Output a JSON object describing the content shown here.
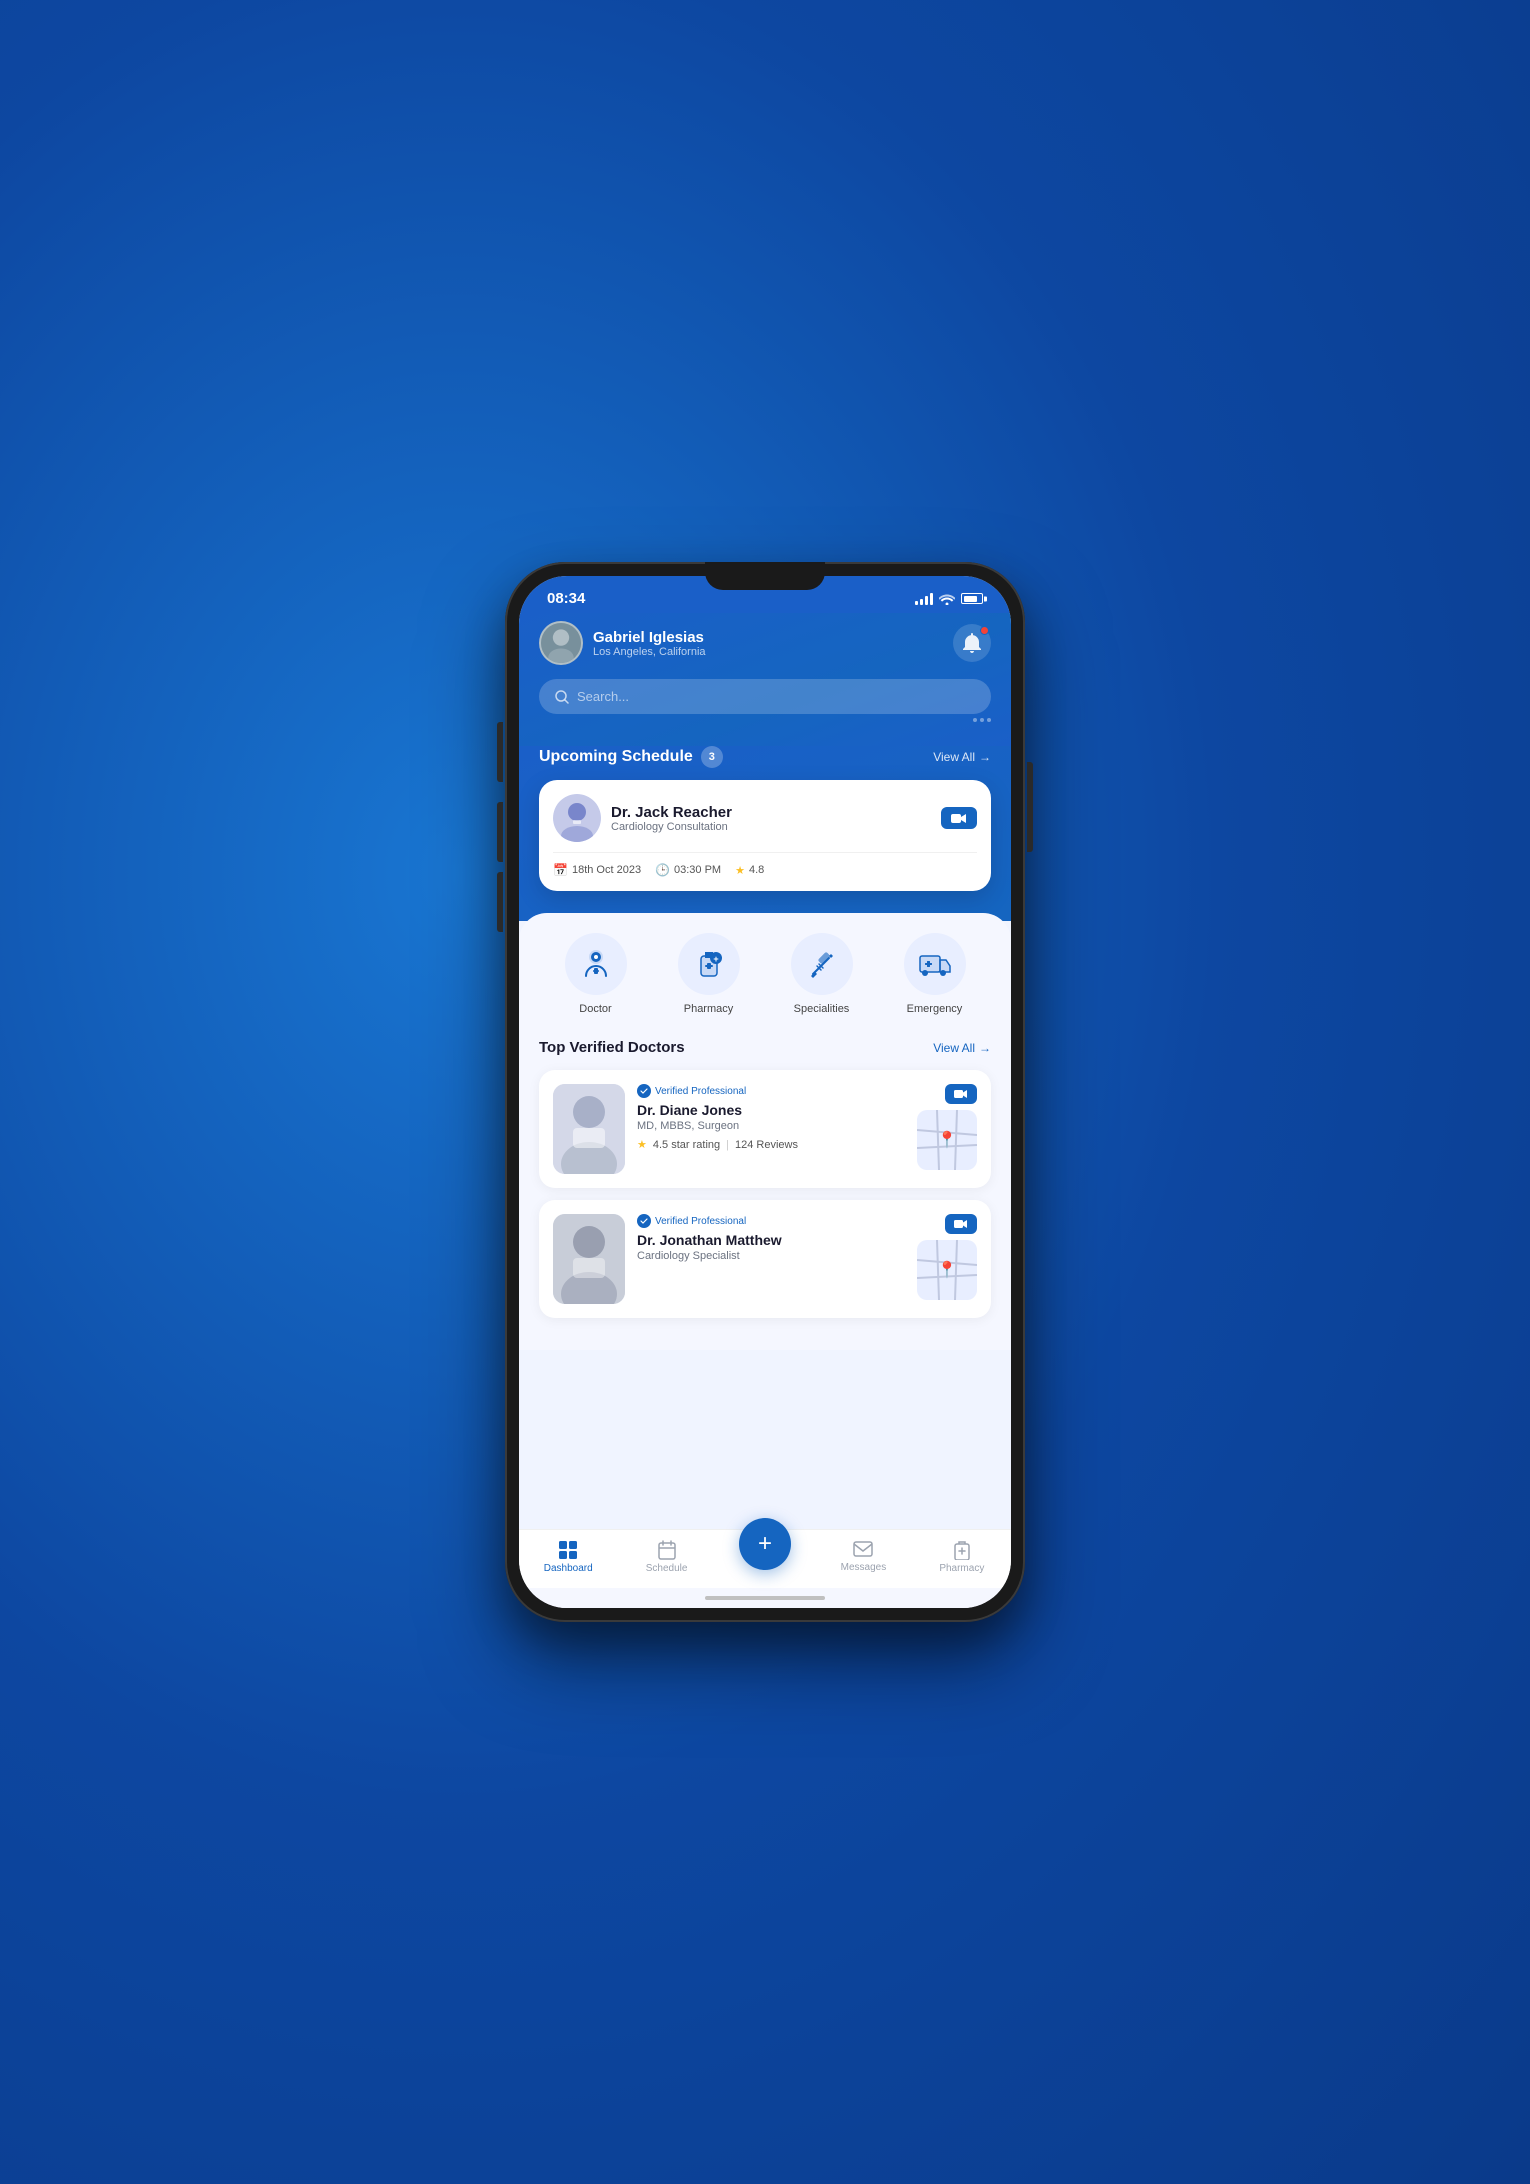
{
  "status_bar": {
    "time": "08:34",
    "battery_label": "battery"
  },
  "header": {
    "user_name": "Gabriel Iglesias",
    "user_location": "Los Angeles, California",
    "search_placeholder": "Search..."
  },
  "schedule": {
    "title": "Upcoming Schedule",
    "count": "3",
    "view_all": "View All",
    "doctor": {
      "name": "Dr. Jack Reacher",
      "specialty": "Cardiology Consultation",
      "date": "18th Oct 2023",
      "time": "03:30 PM",
      "rating": "4.8"
    }
  },
  "categories": [
    {
      "id": "doctor",
      "label": "Doctor"
    },
    {
      "id": "pharmacy",
      "label": "Pharmacy"
    },
    {
      "id": "specialities",
      "label": "Specialities"
    },
    {
      "id": "emergency",
      "label": "Emergency"
    }
  ],
  "top_doctors": {
    "title": "Top Verified Doctors",
    "view_all": "View All",
    "doctors": [
      {
        "name": "Dr. Diane Jones",
        "credentials": "MD, MBBS, Surgeon",
        "rating": "4.5 star rating",
        "reviews": "124 Reviews",
        "verified": "Verified Professional"
      },
      {
        "name": "Dr. Jonathan Matthew",
        "credentials": "Cardiology Specialist",
        "verified": "Verified Professional"
      }
    ]
  },
  "bottom_nav": {
    "items": [
      {
        "id": "dashboard",
        "label": "Dashboard",
        "active": true
      },
      {
        "id": "schedule",
        "label": "Schedule",
        "active": false
      },
      {
        "id": "add",
        "label": "+",
        "active": false
      },
      {
        "id": "messages",
        "label": "Messages",
        "active": false
      },
      {
        "id": "pharmacy",
        "label": "Pharmacy",
        "active": false
      }
    ]
  }
}
